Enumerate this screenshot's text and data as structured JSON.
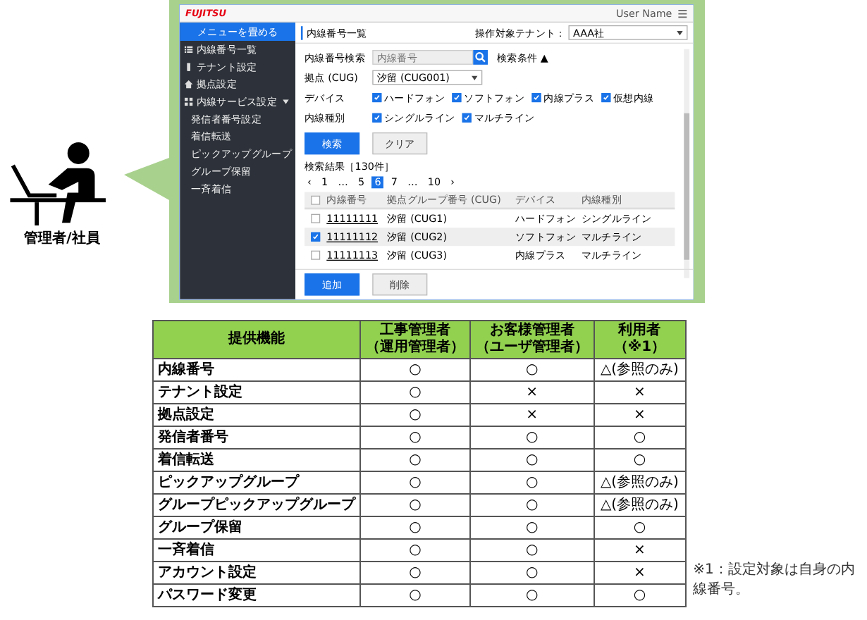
{
  "app": {
    "logo": "FUJITSU",
    "user_name": "User Name",
    "sidebar": {
      "collapse_label": "メニューを畳める",
      "items": [
        {
          "label": "内線番号一覧"
        },
        {
          "label": "テナント設定"
        },
        {
          "label": "拠点設定"
        },
        {
          "label": "内線サービス設定",
          "expanded": true,
          "children": [
            {
              "label": "発信者番号設定"
            },
            {
              "label": "着信転送"
            },
            {
              "label": "ピックアップグループ"
            },
            {
              "label": "グループ保留"
            },
            {
              "label": "一斉着信"
            }
          ]
        }
      ]
    },
    "title": "内線番号一覧",
    "tenant_label": "操作対象テナント：",
    "tenant_value": "AAA社",
    "search": {
      "label": "内線番号検索",
      "placeholder": "内線番号",
      "toggle": "検索条件 ▲"
    },
    "filters": [
      {
        "kind": "select",
        "label": "拠点 (CUG)",
        "value": "汐留 (CUG001)"
      },
      {
        "kind": "checks",
        "label": "デバイス",
        "options": [
          {
            "label": "ハードフォン",
            "checked": true
          },
          {
            "label": "ソフトフォン",
            "checked": true
          },
          {
            "label": "内線プラス",
            "checked": true
          },
          {
            "label": "仮想内線",
            "checked": true
          }
        ]
      },
      {
        "kind": "checks",
        "label": "内線種別",
        "options": [
          {
            "label": "シングルライン",
            "checked": true
          },
          {
            "label": "マルチライン",
            "checked": true
          }
        ]
      }
    ],
    "search_button": "検索",
    "clear_button": "クリア",
    "results_label": "検索結果［130件］",
    "pagination": [
      {
        "label": "‹",
        "selected": false
      },
      {
        "label": "1",
        "selected": false
      },
      {
        "label": "…",
        "selected": false
      },
      {
        "label": "5",
        "selected": false
      },
      {
        "label": "6",
        "selected": true
      },
      {
        "label": "7",
        "selected": false
      },
      {
        "label": "…",
        "selected": false
      },
      {
        "label": "10",
        "selected": false
      },
      {
        "label": "›",
        "selected": false
      }
    ],
    "select_all_checked": false,
    "columns": [
      "内線番号",
      "拠点グループ番号 (CUG)",
      "デバイス",
      "内線種別"
    ],
    "rows": [
      {
        "checked": false,
        "cells": [
          "11111111",
          "汐留 (CUG1)",
          "ハードフォン",
          "シングルライン"
        ]
      },
      {
        "checked": true,
        "cells": [
          "11111112",
          "汐留 (CUG2)",
          "ソフトフォン",
          "マルチライン"
        ]
      },
      {
        "checked": false,
        "cells": [
          "11111113",
          "汐留 (CUG3)",
          "内線プラス",
          "マルチライン"
        ]
      }
    ],
    "add_button": "追加",
    "delete_button": "削除"
  },
  "person_caption": "管理者/社員",
  "permissions": {
    "columns": [
      "提供機能",
      "工事管理者（運用管理者）",
      "お客様管理者（ユーザ管理者）",
      "利用者（※1）"
    ],
    "rows": [
      [
        "内線番号",
        "○",
        "○",
        "△(参照のみ)"
      ],
      [
        "テナント設定",
        "○",
        "×",
        "×"
      ],
      [
        "拠点設定",
        "○",
        "×",
        "×"
      ],
      [
        "発信者番号",
        "○",
        "○",
        "○"
      ],
      [
        "着信転送",
        "○",
        "○",
        "○"
      ],
      [
        "ピックアップグループ",
        "○",
        "○",
        "△(参照のみ)"
      ],
      [
        "グループピックアップグループ",
        "○",
        "○",
        "△(参照のみ)"
      ],
      [
        "グループ保留",
        "○",
        "○",
        "○"
      ],
      [
        "一斉着信",
        "○",
        "○",
        "×"
      ],
      [
        "アカウント設定",
        "○",
        "○",
        "×"
      ],
      [
        "パスワード変更",
        "○",
        "○",
        "○"
      ]
    ]
  },
  "note": "※1：設定対象は自身の内線番号。"
}
